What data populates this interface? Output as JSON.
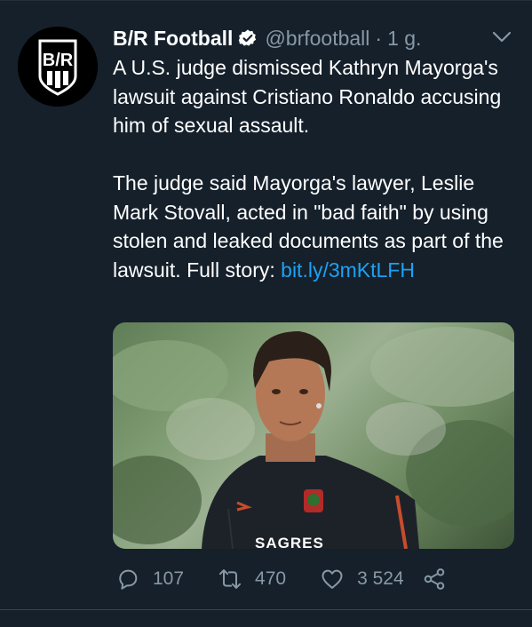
{
  "tweet": {
    "account_name": "B/R Football",
    "handle": "@brfootball",
    "separator": "·",
    "time": "1 g.",
    "text_p1": "A U.S. judge dismissed Kathryn Mayorga's lawsuit against Cristiano Ronaldo accusing him of sexual assault.",
    "text_p2": "The judge said Mayorga's lawyer, Leslie Mark Stovall, acted in \"bad faith\" by using stolen and leaked documents as part of the lawsuit. Full story: ",
    "link": "bit.ly/3mKtLFH",
    "jersey_text": "SAGRES",
    "avatar_text": "B/R"
  },
  "actions": {
    "replies": "107",
    "retweets": "470",
    "likes": "3 524"
  },
  "colors": {
    "background": "#15202b",
    "text_secondary": "#8899a6",
    "link": "#1da1f2",
    "verified": "#ffffff"
  },
  "icons": [
    "verified-badge-icon",
    "chevron-down-icon",
    "reply-icon",
    "retweet-icon",
    "like-icon",
    "share-icon"
  ]
}
